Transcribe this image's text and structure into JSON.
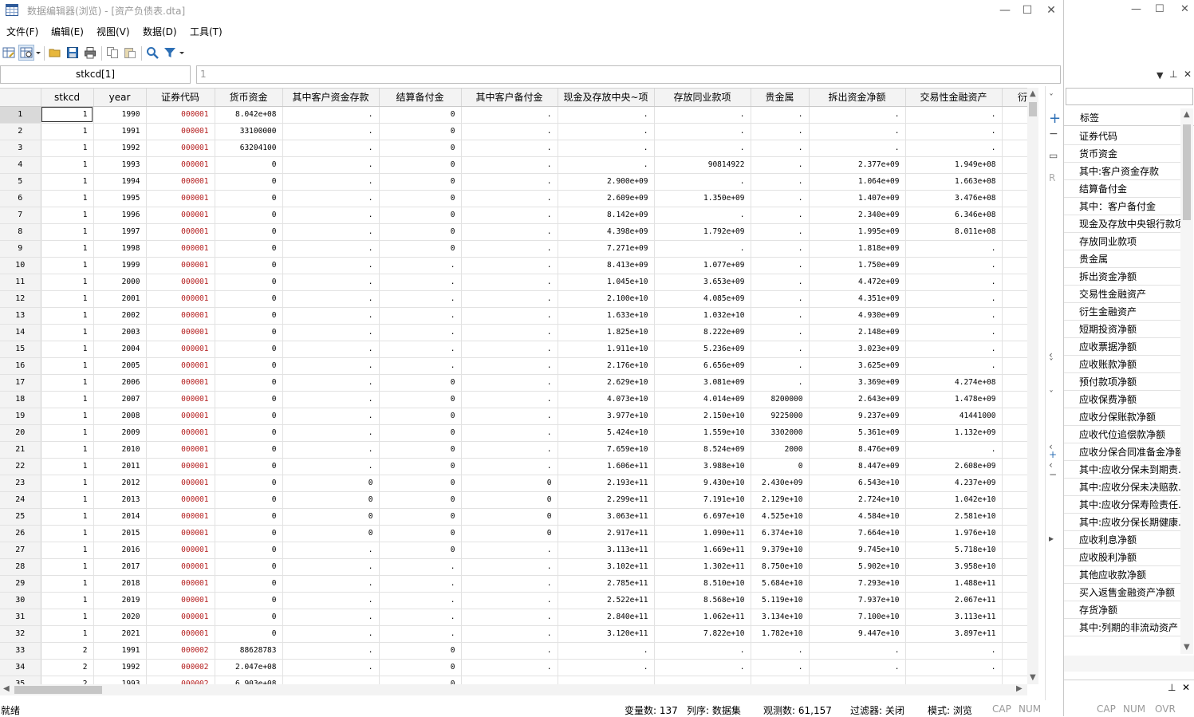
{
  "window": {
    "title": "数据编辑器(浏览) - [资产负债表.dta]",
    "minimize": "—",
    "maximize": "☐",
    "close": "✕"
  },
  "menu": [
    "文件(F)",
    "编辑(E)",
    "视图(V)",
    "数据(D)",
    "工具(T)"
  ],
  "toolbar": {
    "icons": [
      "data-editor-edit-icon",
      "data-editor-browse-icon",
      "open-folder-icon",
      "save-icon",
      "print-icon",
      "copy-icon",
      "paste-icon",
      "find-icon",
      "filter-icon"
    ]
  },
  "cellbar": {
    "variable": "stkcd[1]",
    "value": "1"
  },
  "grid": {
    "columns": [
      "stkcd",
      "year",
      "证券代码",
      "货币资金",
      "其中客户资金存款",
      "结算备付金",
      "其中客户备付金",
      "现金及存放中央~项",
      "存放同业款项",
      "贵金属",
      "拆出资金净额",
      "交易性金融资产",
      "衍"
    ],
    "rows": [
      [
        "1",
        "1",
        "1990",
        "000001",
        "8.042e+08",
        ".",
        "0",
        ".",
        ".",
        ".",
        ".",
        ".",
        "."
      ],
      [
        "2",
        "1",
        "1991",
        "000001",
        "33100000",
        ".",
        "0",
        ".",
        ".",
        ".",
        ".",
        ".",
        "."
      ],
      [
        "3",
        "1",
        "1992",
        "000001",
        "63204100",
        ".",
        "0",
        ".",
        ".",
        ".",
        ".",
        ".",
        "."
      ],
      [
        "4",
        "1",
        "1993",
        "000001",
        "0",
        ".",
        "0",
        ".",
        ".",
        "90814922",
        ".",
        "2.377e+09",
        "1.949e+08"
      ],
      [
        "5",
        "1",
        "1994",
        "000001",
        "0",
        ".",
        "0",
        ".",
        "2.900e+09",
        ".",
        ".",
        "1.064e+09",
        "1.663e+08"
      ],
      [
        "6",
        "1",
        "1995",
        "000001",
        "0",
        ".",
        "0",
        ".",
        "2.609e+09",
        "1.350e+09",
        ".",
        "1.407e+09",
        "3.476e+08"
      ],
      [
        "7",
        "1",
        "1996",
        "000001",
        "0",
        ".",
        "0",
        ".",
        "8.142e+09",
        ".",
        ".",
        "2.340e+09",
        "6.346e+08"
      ],
      [
        "8",
        "1",
        "1997",
        "000001",
        "0",
        ".",
        "0",
        ".",
        "4.398e+09",
        "1.792e+09",
        ".",
        "1.995e+09",
        "8.011e+08"
      ],
      [
        "9",
        "1",
        "1998",
        "000001",
        "0",
        ".",
        "0",
        ".",
        "7.271e+09",
        ".",
        ".",
        "1.818e+09",
        "."
      ],
      [
        "10",
        "1",
        "1999",
        "000001",
        "0",
        ".",
        ".",
        ".",
        "8.413e+09",
        "1.077e+09",
        ".",
        "1.750e+09",
        "."
      ],
      [
        "11",
        "1",
        "2000",
        "000001",
        "0",
        ".",
        ".",
        ".",
        "1.045e+10",
        "3.653e+09",
        ".",
        "4.472e+09",
        "."
      ],
      [
        "12",
        "1",
        "2001",
        "000001",
        "0",
        ".",
        ".",
        ".",
        "2.100e+10",
        "4.085e+09",
        ".",
        "4.351e+09",
        "."
      ],
      [
        "13",
        "1",
        "2002",
        "000001",
        "0",
        ".",
        ".",
        ".",
        "1.633e+10",
        "1.032e+10",
        ".",
        "4.930e+09",
        "."
      ],
      [
        "14",
        "1",
        "2003",
        "000001",
        "0",
        ".",
        ".",
        ".",
        "1.825e+10",
        "8.222e+09",
        ".",
        "2.148e+09",
        "."
      ],
      [
        "15",
        "1",
        "2004",
        "000001",
        "0",
        ".",
        ".",
        ".",
        "1.911e+10",
        "5.236e+09",
        ".",
        "3.023e+09",
        "."
      ],
      [
        "16",
        "1",
        "2005",
        "000001",
        "0",
        ".",
        ".",
        ".",
        "2.176e+10",
        "6.656e+09",
        ".",
        "3.625e+09",
        "."
      ],
      [
        "17",
        "1",
        "2006",
        "000001",
        "0",
        ".",
        "0",
        ".",
        "2.629e+10",
        "3.081e+09",
        ".",
        "3.369e+09",
        "4.274e+08"
      ],
      [
        "18",
        "1",
        "2007",
        "000001",
        "0",
        ".",
        "0",
        ".",
        "4.073e+10",
        "4.014e+09",
        "8200000",
        "2.643e+09",
        "1.478e+09"
      ],
      [
        "19",
        "1",
        "2008",
        "000001",
        "0",
        ".",
        "0",
        ".",
        "3.977e+10",
        "2.150e+10",
        "9225000",
        "9.237e+09",
        "41441000"
      ],
      [
        "20",
        "1",
        "2009",
        "000001",
        "0",
        ".",
        "0",
        ".",
        "5.424e+10",
        "1.559e+10",
        "3302000",
        "5.361e+09",
        "1.132e+09"
      ],
      [
        "21",
        "1",
        "2010",
        "000001",
        "0",
        ".",
        "0",
        ".",
        "7.659e+10",
        "8.524e+09",
        "2000",
        "8.476e+09",
        "."
      ],
      [
        "22",
        "1",
        "2011",
        "000001",
        "0",
        ".",
        "0",
        ".",
        "1.606e+11",
        "3.988e+10",
        "0",
        "8.447e+09",
        "2.608e+09"
      ],
      [
        "23",
        "1",
        "2012",
        "000001",
        "0",
        "0",
        "0",
        "0",
        "2.193e+11",
        "9.430e+10",
        "2.430e+09",
        "6.543e+10",
        "4.237e+09"
      ],
      [
        "24",
        "1",
        "2013",
        "000001",
        "0",
        "0",
        "0",
        "0",
        "2.299e+11",
        "7.191e+10",
        "2.129e+10",
        "2.724e+10",
        "1.042e+10"
      ],
      [
        "25",
        "1",
        "2014",
        "000001",
        "0",
        "0",
        "0",
        "0",
        "3.063e+11",
        "6.697e+10",
        "4.525e+10",
        "4.584e+10",
        "2.581e+10"
      ],
      [
        "26",
        "1",
        "2015",
        "000001",
        "0",
        "0",
        "0",
        "0",
        "2.917e+11",
        "1.090e+11",
        "6.374e+10",
        "7.664e+10",
        "1.976e+10"
      ],
      [
        "27",
        "1",
        "2016",
        "000001",
        "0",
        ".",
        "0",
        ".",
        "3.113e+11",
        "1.669e+11",
        "9.379e+10",
        "9.745e+10",
        "5.718e+10"
      ],
      [
        "28",
        "1",
        "2017",
        "000001",
        "0",
        ".",
        ".",
        ".",
        "3.102e+11",
        "1.302e+11",
        "8.750e+10",
        "5.902e+10",
        "3.958e+10"
      ],
      [
        "29",
        "1",
        "2018",
        "000001",
        "0",
        ".",
        ".",
        ".",
        "2.785e+11",
        "8.510e+10",
        "5.684e+10",
        "7.293e+10",
        "1.488e+11"
      ],
      [
        "30",
        "1",
        "2019",
        "000001",
        "0",
        ".",
        ".",
        ".",
        "2.522e+11",
        "8.568e+10",
        "5.119e+10",
        "7.937e+10",
        "2.067e+11"
      ],
      [
        "31",
        "1",
        "2020",
        "000001",
        "0",
        ".",
        ".",
        ".",
        "2.840e+11",
        "1.062e+11",
        "3.134e+10",
        "7.100e+10",
        "3.113e+11"
      ],
      [
        "32",
        "1",
        "2021",
        "000001",
        "0",
        ".",
        ".",
        ".",
        "3.120e+11",
        "7.822e+10",
        "1.782e+10",
        "9.447e+10",
        "3.897e+11"
      ],
      [
        "33",
        "2",
        "1991",
        "000002",
        "88628783",
        ".",
        "0",
        ".",
        ".",
        ".",
        ".",
        ".",
        "."
      ],
      [
        "34",
        "2",
        "1992",
        "000002",
        "2.047e+08",
        ".",
        "0",
        ".",
        ".",
        ".",
        ".",
        ".",
        "."
      ],
      [
        "35",
        "2",
        "1993",
        "000002",
        "6.903e+08",
        ".",
        "0",
        ".",
        ".",
        ".",
        ".",
        ".",
        "."
      ]
    ]
  },
  "status": {
    "ready": "就绪",
    "vars": "变量数: 137",
    "sort": "列序: 数据集",
    "obs": "观测数: 61,157",
    "filter": "过滤器: 关闭",
    "mode": "模式: 浏览",
    "cap": "CAP",
    "num": "NUM",
    "cap2": "CAP",
    "num2": "NUM",
    "ovr": "OVR"
  },
  "varwindow": {
    "header": "标签",
    "items": [
      "证券代码",
      "货币资金",
      "其中:客户资金存款",
      "结算备付金",
      "其中：客户备付金",
      "现金及存放中央银行款项",
      "存放同业款项",
      "贵金属",
      "拆出资金净额",
      "交易性金融资产",
      "衍生金融资产",
      "短期投资净额",
      "应收票据净额",
      "应收账款净额",
      "预付款项净额",
      "应收保费净额",
      "应收分保账款净额",
      "应收代位追偿款净额",
      "应收分保合同准备金净额",
      "其中:应收分保未到期责.",
      "其中:应收分保未决赔款.",
      "其中:应收分保寿险责任.",
      "其中:应收分保长期健康.",
      "应收利息净额",
      "应收股利净额",
      "其他应收款净额",
      "买入返售金融资产净额",
      "存货净额",
      "其中:列期的非流动资产"
    ]
  },
  "midstrip": [
    "ˇ",
    "+",
    "−",
    "▭",
    "R",
    "ˇ",
    "‹",
    "ˇ",
    "‹",
    "‹",
    "+",
    "−",
    "▸"
  ]
}
